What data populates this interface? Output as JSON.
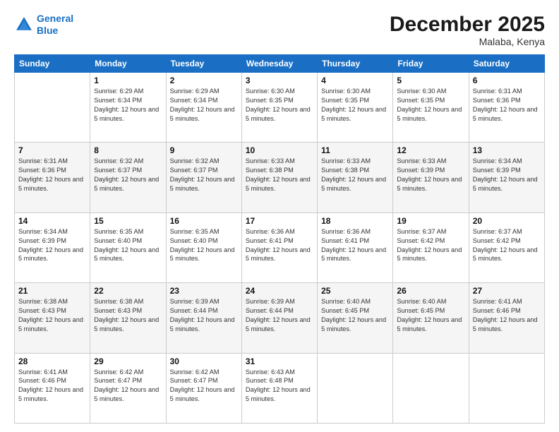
{
  "logo": {
    "line1": "General",
    "line2": "Blue"
  },
  "title": "December 2025",
  "location": "Malaba, Kenya",
  "days_of_week": [
    "Sunday",
    "Monday",
    "Tuesday",
    "Wednesday",
    "Thursday",
    "Friday",
    "Saturday"
  ],
  "weeks": [
    [
      {
        "num": "",
        "empty": true
      },
      {
        "num": "1",
        "sunrise": "Sunrise: 6:29 AM",
        "sunset": "Sunset: 6:34 PM",
        "daylight": "Daylight: 12 hours and 5 minutes."
      },
      {
        "num": "2",
        "sunrise": "Sunrise: 6:29 AM",
        "sunset": "Sunset: 6:34 PM",
        "daylight": "Daylight: 12 hours and 5 minutes."
      },
      {
        "num": "3",
        "sunrise": "Sunrise: 6:30 AM",
        "sunset": "Sunset: 6:35 PM",
        "daylight": "Daylight: 12 hours and 5 minutes."
      },
      {
        "num": "4",
        "sunrise": "Sunrise: 6:30 AM",
        "sunset": "Sunset: 6:35 PM",
        "daylight": "Daylight: 12 hours and 5 minutes."
      },
      {
        "num": "5",
        "sunrise": "Sunrise: 6:30 AM",
        "sunset": "Sunset: 6:35 PM",
        "daylight": "Daylight: 12 hours and 5 minutes."
      },
      {
        "num": "6",
        "sunrise": "Sunrise: 6:31 AM",
        "sunset": "Sunset: 6:36 PM",
        "daylight": "Daylight: 12 hours and 5 minutes."
      }
    ],
    [
      {
        "num": "7",
        "sunrise": "Sunrise: 6:31 AM",
        "sunset": "Sunset: 6:36 PM",
        "daylight": "Daylight: 12 hours and 5 minutes."
      },
      {
        "num": "8",
        "sunrise": "Sunrise: 6:32 AM",
        "sunset": "Sunset: 6:37 PM",
        "daylight": "Daylight: 12 hours and 5 minutes."
      },
      {
        "num": "9",
        "sunrise": "Sunrise: 6:32 AM",
        "sunset": "Sunset: 6:37 PM",
        "daylight": "Daylight: 12 hours and 5 minutes."
      },
      {
        "num": "10",
        "sunrise": "Sunrise: 6:33 AM",
        "sunset": "Sunset: 6:38 PM",
        "daylight": "Daylight: 12 hours and 5 minutes."
      },
      {
        "num": "11",
        "sunrise": "Sunrise: 6:33 AM",
        "sunset": "Sunset: 6:38 PM",
        "daylight": "Daylight: 12 hours and 5 minutes."
      },
      {
        "num": "12",
        "sunrise": "Sunrise: 6:33 AM",
        "sunset": "Sunset: 6:39 PM",
        "daylight": "Daylight: 12 hours and 5 minutes."
      },
      {
        "num": "13",
        "sunrise": "Sunrise: 6:34 AM",
        "sunset": "Sunset: 6:39 PM",
        "daylight": "Daylight: 12 hours and 5 minutes."
      }
    ],
    [
      {
        "num": "14",
        "sunrise": "Sunrise: 6:34 AM",
        "sunset": "Sunset: 6:39 PM",
        "daylight": "Daylight: 12 hours and 5 minutes."
      },
      {
        "num": "15",
        "sunrise": "Sunrise: 6:35 AM",
        "sunset": "Sunset: 6:40 PM",
        "daylight": "Daylight: 12 hours and 5 minutes."
      },
      {
        "num": "16",
        "sunrise": "Sunrise: 6:35 AM",
        "sunset": "Sunset: 6:40 PM",
        "daylight": "Daylight: 12 hours and 5 minutes."
      },
      {
        "num": "17",
        "sunrise": "Sunrise: 6:36 AM",
        "sunset": "Sunset: 6:41 PM",
        "daylight": "Daylight: 12 hours and 5 minutes."
      },
      {
        "num": "18",
        "sunrise": "Sunrise: 6:36 AM",
        "sunset": "Sunset: 6:41 PM",
        "daylight": "Daylight: 12 hours and 5 minutes."
      },
      {
        "num": "19",
        "sunrise": "Sunrise: 6:37 AM",
        "sunset": "Sunset: 6:42 PM",
        "daylight": "Daylight: 12 hours and 5 minutes."
      },
      {
        "num": "20",
        "sunrise": "Sunrise: 6:37 AM",
        "sunset": "Sunset: 6:42 PM",
        "daylight": "Daylight: 12 hours and 5 minutes."
      }
    ],
    [
      {
        "num": "21",
        "sunrise": "Sunrise: 6:38 AM",
        "sunset": "Sunset: 6:43 PM",
        "daylight": "Daylight: 12 hours and 5 minutes."
      },
      {
        "num": "22",
        "sunrise": "Sunrise: 6:38 AM",
        "sunset": "Sunset: 6:43 PM",
        "daylight": "Daylight: 12 hours and 5 minutes."
      },
      {
        "num": "23",
        "sunrise": "Sunrise: 6:39 AM",
        "sunset": "Sunset: 6:44 PM",
        "daylight": "Daylight: 12 hours and 5 minutes."
      },
      {
        "num": "24",
        "sunrise": "Sunrise: 6:39 AM",
        "sunset": "Sunset: 6:44 PM",
        "daylight": "Daylight: 12 hours and 5 minutes."
      },
      {
        "num": "25",
        "sunrise": "Sunrise: 6:40 AM",
        "sunset": "Sunset: 6:45 PM",
        "daylight": "Daylight: 12 hours and 5 minutes."
      },
      {
        "num": "26",
        "sunrise": "Sunrise: 6:40 AM",
        "sunset": "Sunset: 6:45 PM",
        "daylight": "Daylight: 12 hours and 5 minutes."
      },
      {
        "num": "27",
        "sunrise": "Sunrise: 6:41 AM",
        "sunset": "Sunset: 6:46 PM",
        "daylight": "Daylight: 12 hours and 5 minutes."
      }
    ],
    [
      {
        "num": "28",
        "sunrise": "Sunrise: 6:41 AM",
        "sunset": "Sunset: 6:46 PM",
        "daylight": "Daylight: 12 hours and 5 minutes."
      },
      {
        "num": "29",
        "sunrise": "Sunrise: 6:42 AM",
        "sunset": "Sunset: 6:47 PM",
        "daylight": "Daylight: 12 hours and 5 minutes."
      },
      {
        "num": "30",
        "sunrise": "Sunrise: 6:42 AM",
        "sunset": "Sunset: 6:47 PM",
        "daylight": "Daylight: 12 hours and 5 minutes."
      },
      {
        "num": "31",
        "sunrise": "Sunrise: 6:43 AM",
        "sunset": "Sunset: 6:48 PM",
        "daylight": "Daylight: 12 hours and 5 minutes."
      },
      {
        "num": "",
        "empty": true
      },
      {
        "num": "",
        "empty": true
      },
      {
        "num": "",
        "empty": true
      }
    ]
  ]
}
